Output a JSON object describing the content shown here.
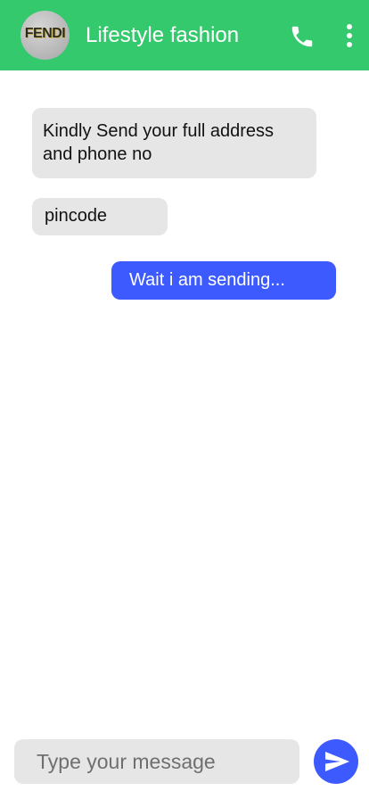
{
  "header": {
    "avatar_text": "FENDI",
    "title": "Lifestyle fashion",
    "call_icon": "phone-icon",
    "menu_icon": "more-vert-icon",
    "bg_color": "#35c96d"
  },
  "messages": [
    {
      "direction": "incoming",
      "text": "Kindly Send your full address and phone no"
    },
    {
      "direction": "incoming",
      "text": "pincode"
    },
    {
      "direction": "outgoing",
      "text": "Wait i am sending..."
    }
  ],
  "composer": {
    "placeholder": "Type your message",
    "send_icon": "send-icon"
  },
  "colors": {
    "incoming_bubble": "#e6e6e6",
    "outgoing_bubble": "#3d5afe",
    "accent": "#3d5afe"
  }
}
